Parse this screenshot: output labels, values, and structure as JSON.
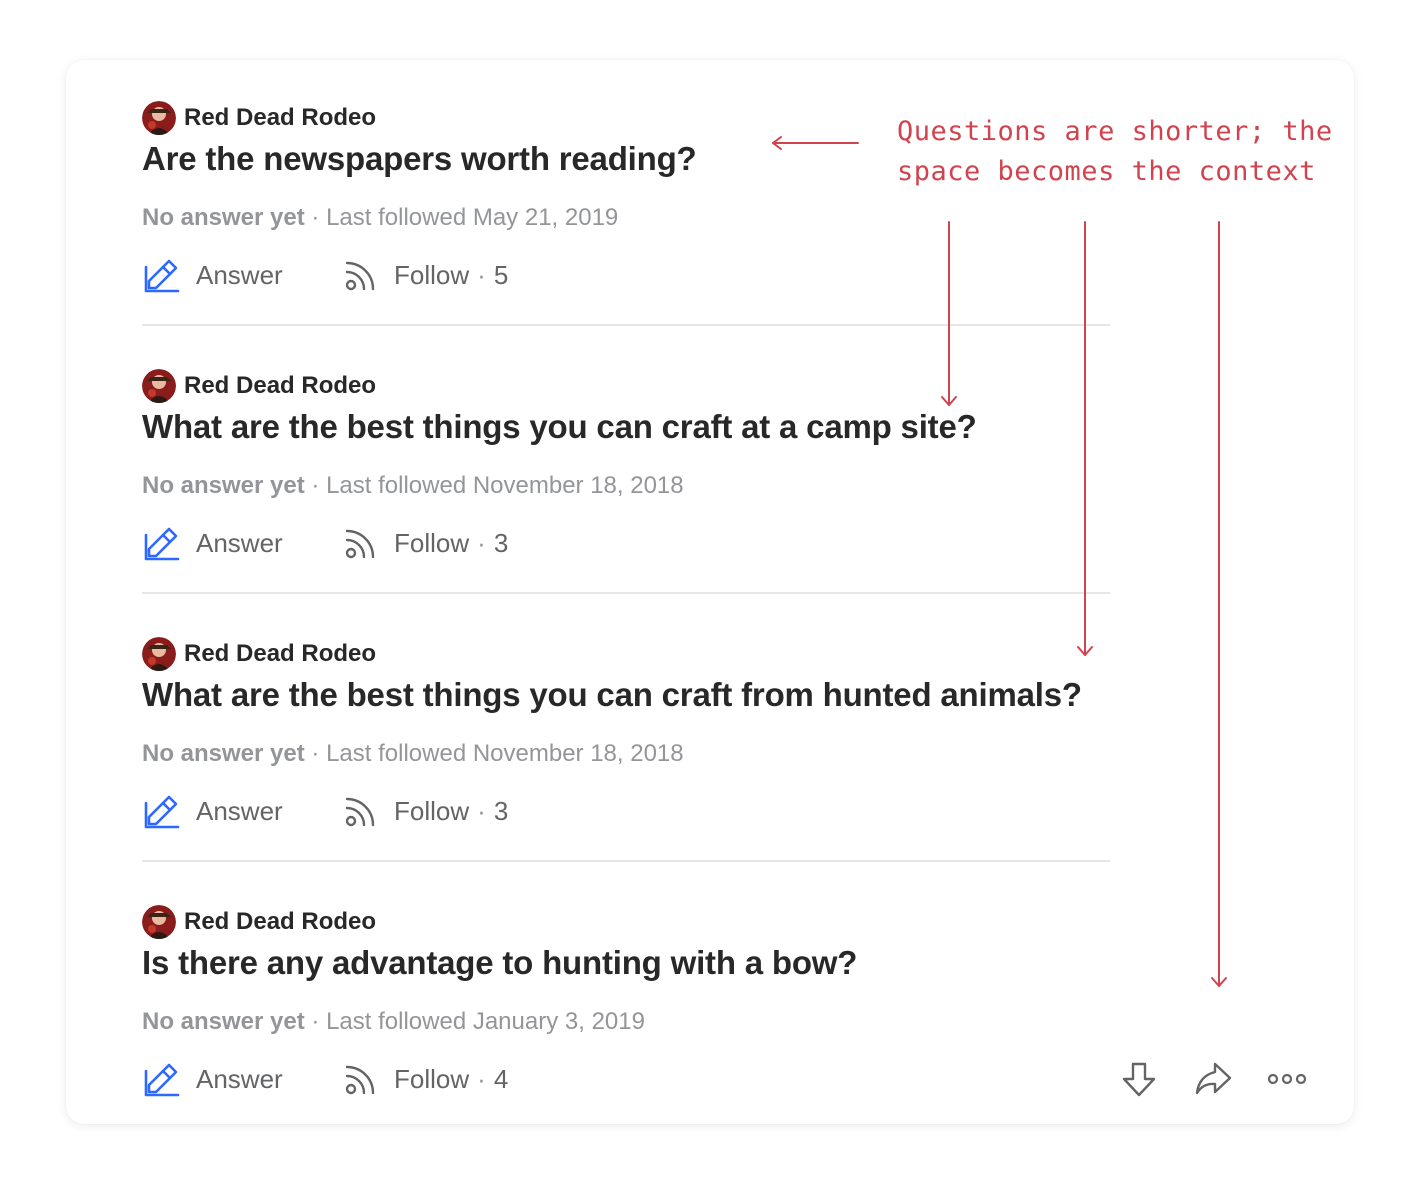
{
  "annotation": {
    "line1": "Questions are shorter; the",
    "line2": "space becomes the context",
    "color": "#d0434f"
  },
  "questions": [
    {
      "author": "Red Dead Rodeo",
      "title": "Are the newspapers worth reading?",
      "status": "No answer yet",
      "separator": "·",
      "followed": "Last followed May 21, 2019",
      "answer_label": "Answer",
      "follow_label": "Follow",
      "follow_count": "5"
    },
    {
      "author": "Red Dead Rodeo",
      "title": "What are the best things you can craft at a camp site?",
      "status": "No answer yet",
      "separator": "·",
      "followed": "Last followed November 18, 2018",
      "answer_label": "Answer",
      "follow_label": "Follow",
      "follow_count": "3"
    },
    {
      "author": "Red Dead Rodeo",
      "title": "What are the best things you can craft from hunted animals?",
      "status": "No answer yet",
      "separator": "·",
      "followed": "Last followed November 18, 2018",
      "answer_label": "Answer",
      "follow_label": "Follow",
      "follow_count": "3"
    },
    {
      "author": "Red Dead Rodeo",
      "title": "Is there any advantage to hunting with a bow?",
      "status": "No answer yet",
      "separator": "·",
      "followed": "Last followed January 3, 2019",
      "answer_label": "Answer",
      "follow_label": "Follow",
      "follow_count": "4"
    }
  ],
  "icons": {
    "answer": "pencil-edit-icon",
    "follow": "follow-feed-icon",
    "downvote": "downvote-arrow-icon",
    "share": "share-arrow-icon",
    "more": "more-options-icon"
  },
  "colors": {
    "answer_icon": "#2e69ff",
    "text_primary": "#282829",
    "text_secondary": "#939598"
  }
}
